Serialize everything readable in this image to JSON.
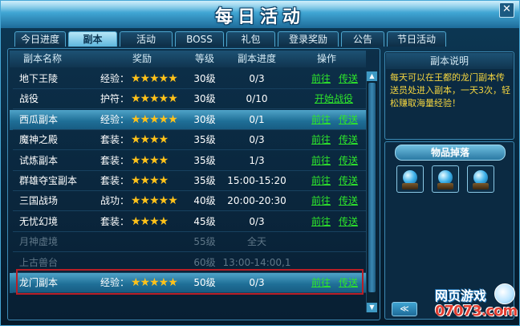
{
  "window": {
    "title": "每日活动",
    "close_icon": "close-icon"
  },
  "tabs": [
    {
      "label": "今日进度",
      "active": false
    },
    {
      "label": "副本",
      "active": true
    },
    {
      "label": "活动",
      "active": false
    },
    {
      "label": "BOSS",
      "active": false
    },
    {
      "label": "礼包",
      "active": false
    },
    {
      "label": "登录奖励",
      "active": false
    },
    {
      "label": "公告",
      "active": false
    },
    {
      "label": "节日活动",
      "active": false
    }
  ],
  "table": {
    "headers": {
      "name": "副本名称",
      "reward": "奖励",
      "level": "等级",
      "progress": "副本进度",
      "action": "操作"
    },
    "rows": [
      {
        "name": "地下王陵",
        "type": "经验：",
        "stars": "★★★★★",
        "level": "30级",
        "progress": "0/3",
        "go": "前往",
        "teleport": "传送",
        "start": "",
        "selected": false,
        "dim": false
      },
      {
        "name": "战役",
        "type": "护符：",
        "stars": "★★★★★",
        "level": "30级",
        "progress": "0/10",
        "go": "",
        "teleport": "",
        "start": "开始战役",
        "selected": false,
        "dim": false
      },
      {
        "name": "西瓜副本",
        "type": "经验：",
        "stars": "★★★★★",
        "level": "30级",
        "progress": "0/1",
        "go": "前往",
        "teleport": "传送",
        "start": "",
        "selected": true,
        "dim": false
      },
      {
        "name": "魔神之殿",
        "type": "套装：",
        "stars": "★★★★",
        "level": "35级",
        "progress": "0/3",
        "go": "前往",
        "teleport": "传送",
        "start": "",
        "selected": false,
        "dim": false
      },
      {
        "name": "试炼副本",
        "type": "套装：",
        "stars": "★★★★",
        "level": "35级",
        "progress": "1/3",
        "go": "前往",
        "teleport": "传送",
        "start": "",
        "selected": false,
        "dim": false
      },
      {
        "name": "群雄夺宝副本",
        "type": "套装：",
        "stars": "★★★★",
        "level": "35级",
        "progress": "15:00-15:20",
        "go": "前往",
        "teleport": "传送",
        "start": "",
        "selected": false,
        "dim": false
      },
      {
        "name": "三国战场",
        "type": "战功：",
        "stars": "★★★★★",
        "level": "40级",
        "progress": "20:00-20:30",
        "go": "前往",
        "teleport": "传送",
        "start": "",
        "selected": false,
        "dim": false
      },
      {
        "name": "无忧幻境",
        "type": "套装：",
        "stars": "★★★★",
        "level": "45级",
        "progress": "0/3",
        "go": "前往",
        "teleport": "传送",
        "start": "",
        "selected": false,
        "dim": false
      },
      {
        "name": "月神虚境",
        "type": "",
        "stars": "",
        "level": "55级",
        "progress": "全天",
        "go": "",
        "teleport": "",
        "start": "",
        "selected": false,
        "dim": true
      },
      {
        "name": "上古兽台",
        "type": "",
        "stars": "",
        "level": "60级",
        "progress": "13:00-14:00,1",
        "go": "",
        "teleport": "",
        "start": "",
        "selected": false,
        "dim": true
      },
      {
        "name": "龙门副本",
        "type": "经验：",
        "stars": "★★★★★",
        "level": "50级",
        "progress": "0/3",
        "go": "前往",
        "teleport": "传送",
        "start": "",
        "selected": true,
        "dim": false
      }
    ]
  },
  "description": {
    "header": "副本说明",
    "text": "每天可以在王都的龙门副本传送员处进入副本，一天3次，轻松赚取海量经验！"
  },
  "drops": {
    "header": "物品掉落",
    "items": [
      "item-orb-icon",
      "item-orb-icon",
      "item-orb-icon"
    ],
    "back_label": "≪"
  },
  "watermark": {
    "text": "网页游戏",
    "site": "07073.com"
  },
  "colors": {
    "accent_link": "#2ee62b",
    "star": "#ffc21a",
    "highlight_border": "#b81e26",
    "desc_text": "#f5d640"
  }
}
